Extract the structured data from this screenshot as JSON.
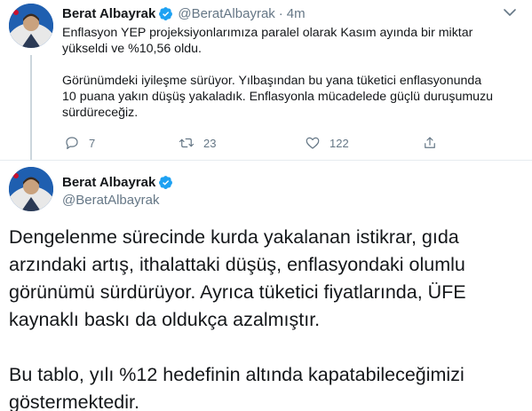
{
  "tweet1": {
    "author_name": "Berat Albayrak",
    "handle": "@BeratAlbayrak",
    "separator": "·",
    "time": "4m",
    "paragraphs": [
      "Enflasyon YEP projeksiyonlarımıza paralel olarak Kasım ayında bir miktar\nyükseldi ve %10,56 oldu.",
      "Görünümdeki iyileşme sürüyor. Yılbaşından bu yana tüketici enflasyonunda\n10 puana yakın düşüş yakaladık. Enflasyonla mücadelede güçlü duruşumuzu\nsürdüreceğiz."
    ],
    "actions": {
      "reply_count": "7",
      "retweet_count": "23",
      "like_count": "122"
    },
    "icons": [
      "verified-badge-icon",
      "caret-down-icon",
      "reply-icon",
      "retweet-icon",
      "like-icon",
      "share-icon"
    ]
  },
  "tweet2": {
    "author_name": "Berat Albayrak",
    "handle": "@BeratAlbayrak",
    "paragraphs": [
      "Dengelenme sürecinde kurda yakalanan istikrar, gıda\narzındaki artış, ithalattaki düşüş, enflasyondaki olumlu\ngörünümü sürdürüyor. Ayrıca tüketici fiyatlarında, ÜFE\nkaynaklı baskı da oldukça azalmıştır.",
      "Bu tablo, yılı %12 hedefinin altında kapatabileceğimizi\ngöstermektedir."
    ]
  },
  "colors": {
    "verified": "#1da1f2",
    "muted_text": "#657786",
    "primary_text": "#14171a",
    "divider": "#e6ecf0",
    "thread_line": "#ccd6dd"
  }
}
